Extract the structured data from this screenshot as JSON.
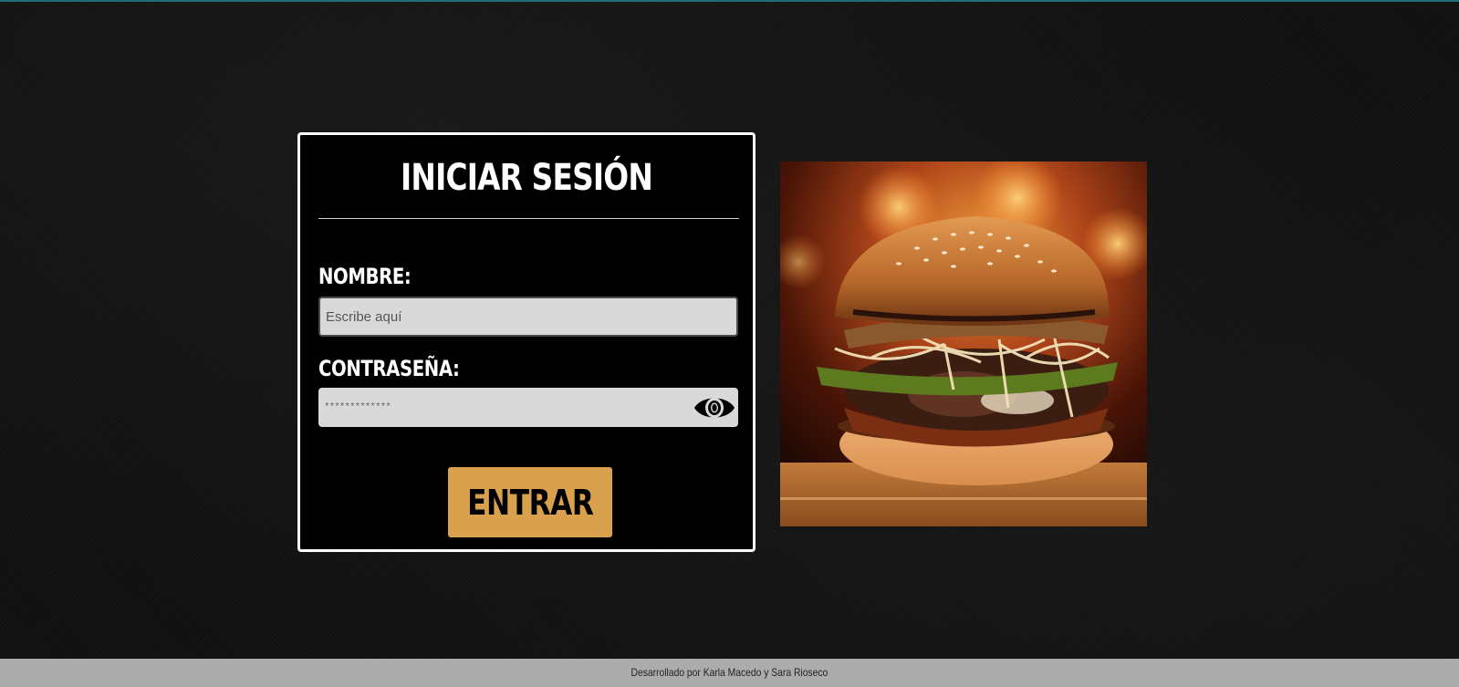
{
  "login": {
    "title": "INICIAR SESIÓN",
    "name_label": "NOMBRE:",
    "name_placeholder": "Escribe aquí",
    "name_value": "",
    "password_label": "CONTRASEÑA:",
    "password_placeholder": "*************",
    "password_value": "",
    "submit_label": "ENTRAR"
  },
  "footer": {
    "credit": "Desarrollado por Karla Macedo y Sara Rioseco"
  },
  "icons": {
    "password_toggle": "eye-icon"
  },
  "colors": {
    "submit_button": "#d9a04e",
    "input_background": "#d9d9d9",
    "card_background": "#000000",
    "card_border": "#ffffff",
    "footer_background": "#acacac"
  }
}
